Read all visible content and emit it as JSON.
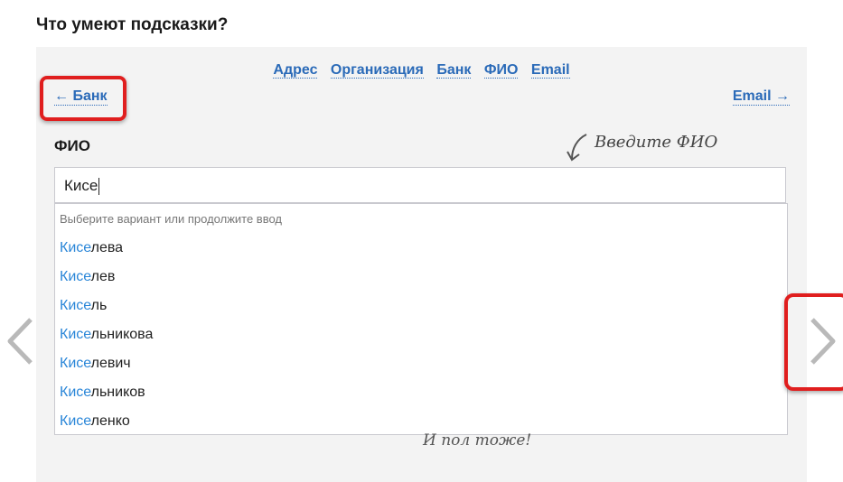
{
  "page": {
    "title": "Что умеют подсказки?"
  },
  "tabs": [
    "Адрес",
    "Организация",
    "Банк",
    "ФИО",
    "Email"
  ],
  "nav": {
    "prev": "← Банк",
    "next": "Email →"
  },
  "form": {
    "label": "ФИО",
    "hint": "Введите ФИО",
    "hint_bottom": "И пол тоже!",
    "input_value": "Кисе"
  },
  "suggestions": {
    "hint": "Выберите вариант или продолжите ввод",
    "items": [
      {
        "match": "Кисе",
        "rest": "лева"
      },
      {
        "match": "Кисе",
        "rest": "лев"
      },
      {
        "match": "Кисе",
        "rest": "ль"
      },
      {
        "match": "Кисе",
        "rest": "льникова"
      },
      {
        "match": "Кисе",
        "rest": "левич"
      },
      {
        "match": "Кисе",
        "rest": "льников"
      },
      {
        "match": "Кисе",
        "rest": "ленко"
      }
    ]
  },
  "icons": {
    "slide_prev": "chevron-left-icon",
    "slide_next": "chevron-right-icon",
    "hint_arrow": "curved-arrow-icon"
  },
  "colors": {
    "link": "#2a6ab8",
    "match": "#2a86d8",
    "highlight": "#e01e1e",
    "panel_bg": "#f3f3f3"
  }
}
